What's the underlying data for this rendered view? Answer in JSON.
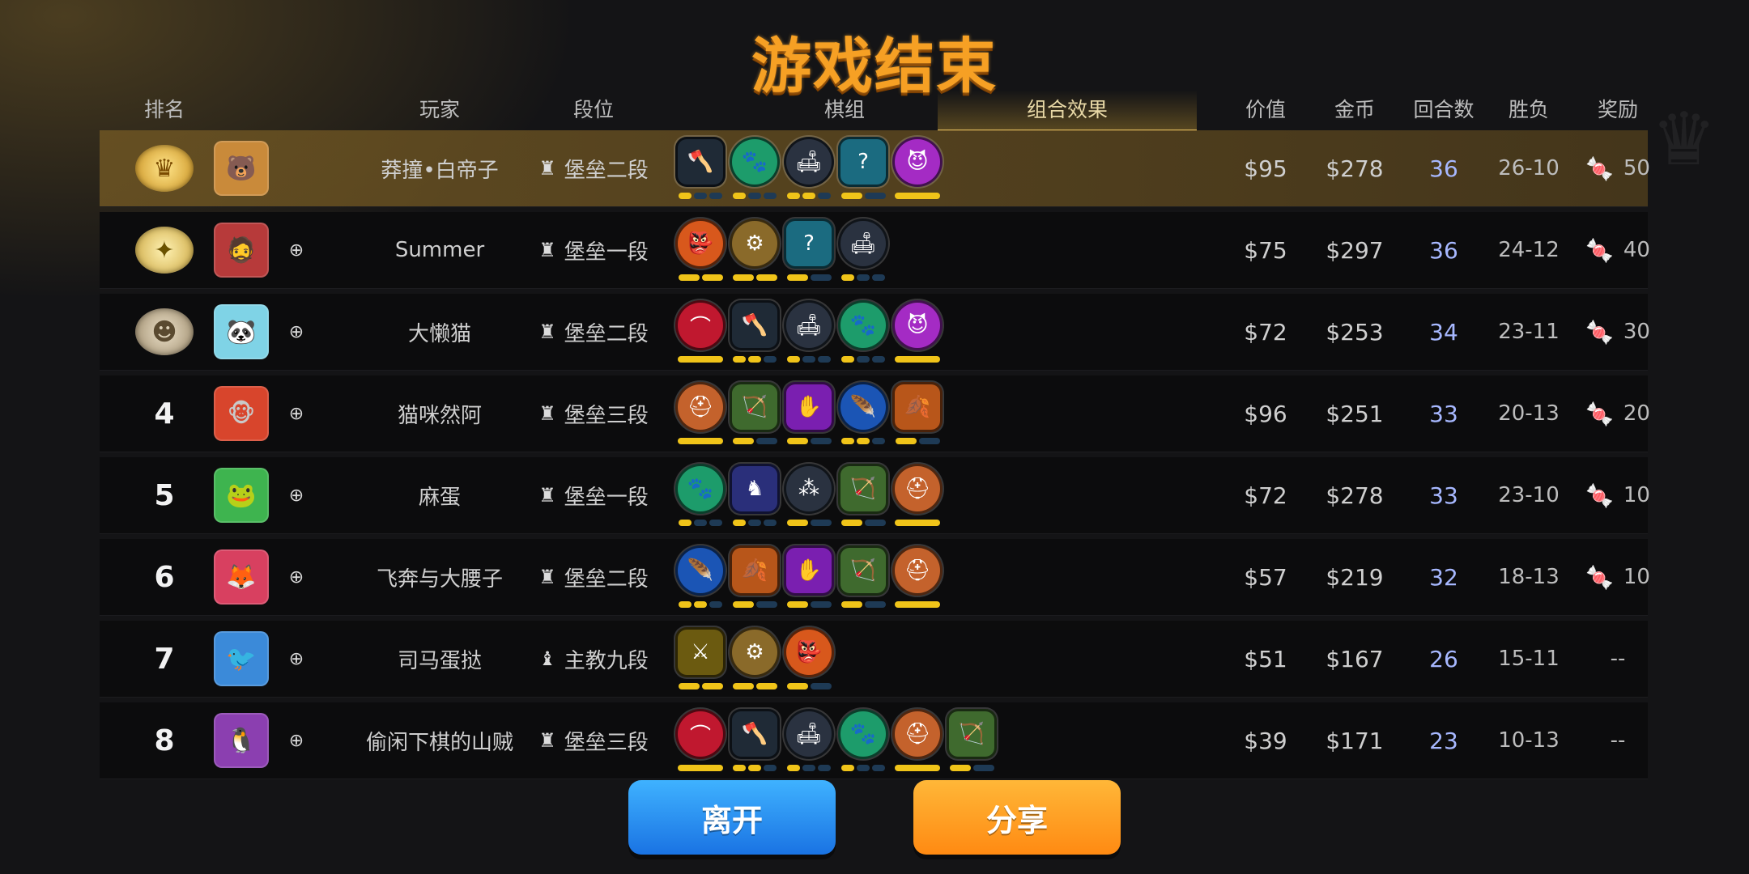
{
  "title": "游戏结束",
  "headers": {
    "rank": "排名",
    "player": "玩家",
    "tier": "段位",
    "pieces": "棋组",
    "synergy_tab": "组合效果",
    "value": "价值",
    "gold": "金币",
    "rounds": "回合数",
    "winloss": "胜负",
    "reward": "奖励"
  },
  "colors": {
    "title": "#f6a024",
    "pip_on": "#f0c419",
    "pip_off": "#1e3a55",
    "rounds": "#a7b8ff",
    "leave": "#1a73e3",
    "share": "#ff8a12"
  },
  "rows": [
    {
      "rank": "1",
      "medal": "gold",
      "avatar": "🐻",
      "avatar_color": "#c98a3a",
      "name": "莽撞•白帝子",
      "tier_icon": "♜",
      "tier": "堡垒二段",
      "value": "$95",
      "gold": "$278",
      "rounds": "36",
      "wl": "26-10",
      "reward_icon": "candy",
      "reward": "50",
      "synergies": [
        {
          "icon": "axe-icon",
          "glyph": "🪓",
          "color": "#1f2a36",
          "shape": "hex",
          "pips": [
            1,
            0,
            0
          ]
        },
        {
          "icon": "paw-icon",
          "glyph": "🐾",
          "color": "#1d9c6b",
          "shape": "circle",
          "pips": [
            1,
            0,
            0
          ]
        },
        {
          "icon": "sofa-icon",
          "glyph": "🛋",
          "color": "#2a3240",
          "shape": "circle",
          "pips": [
            1,
            1,
            0
          ]
        },
        {
          "icon": "mystery-icon",
          "glyph": "?",
          "color": "#1b6b80",
          "shape": "hex",
          "pips": [
            1,
            0
          ]
        },
        {
          "icon": "demon-icon",
          "glyph": "😈",
          "color": "#a42bc4",
          "shape": "circle",
          "pips": [
            1
          ]
        }
      ]
    },
    {
      "rank": "2",
      "medal": "silver-gold",
      "avatar": "🧔",
      "avatar_color": "#b73a3a",
      "name": "Summer",
      "tier_icon": "♜",
      "tier": "堡垒一段",
      "value": "$75",
      "gold": "$297",
      "rounds": "36",
      "wl": "24-12",
      "reward_icon": "candy",
      "reward": "40",
      "synergies": [
        {
          "icon": "goblin-icon",
          "glyph": "👺",
          "color": "#d8581c",
          "shape": "circle",
          "pips": [
            1,
            1
          ]
        },
        {
          "icon": "gear-icon",
          "glyph": "⚙",
          "color": "#8a6a2a",
          "shape": "circle",
          "pips": [
            1,
            1
          ]
        },
        {
          "icon": "mystery-icon",
          "glyph": "?",
          "color": "#1b6b80",
          "shape": "hex",
          "pips": [
            1,
            0
          ]
        },
        {
          "icon": "sofa-icon",
          "glyph": "🛋",
          "color": "#2a3240",
          "shape": "circle",
          "pips": [
            1,
            0,
            0
          ]
        }
      ]
    },
    {
      "rank": "3",
      "medal": "bronze",
      "avatar": "🐼",
      "avatar_color": "#7fd3e6",
      "name": "大懒猫",
      "tier_icon": "♜",
      "tier": "堡垒二段",
      "value": "$72",
      "gold": "$253",
      "rounds": "34",
      "wl": "23-11",
      "reward_icon": "candy",
      "reward": "30",
      "synergies": [
        {
          "icon": "arch-icon",
          "glyph": "⌒",
          "color": "#c0182f",
          "shape": "circle",
          "pips": [
            1
          ]
        },
        {
          "icon": "axe-icon",
          "glyph": "🪓",
          "color": "#1f2a36",
          "shape": "hex",
          "pips": [
            1,
            1,
            0
          ]
        },
        {
          "icon": "sofa-icon",
          "glyph": "🛋",
          "color": "#2a3240",
          "shape": "circle",
          "pips": [
            1,
            0,
            0
          ]
        },
        {
          "icon": "paw-icon",
          "glyph": "🐾",
          "color": "#1d9c6b",
          "shape": "circle",
          "pips": [
            1,
            0,
            0
          ]
        },
        {
          "icon": "demon-icon",
          "glyph": "😈",
          "color": "#a42bc4",
          "shape": "circle",
          "pips": [
            1
          ]
        }
      ]
    },
    {
      "rank": "4",
      "medal": "none",
      "avatar": "🐵",
      "avatar_color": "#d8452c",
      "name": "猫咪然阿",
      "tier_icon": "♜",
      "tier": "堡垒三段",
      "value": "$96",
      "gold": "$251",
      "rounds": "33",
      "wl": "20-13",
      "reward_icon": "candy",
      "reward": "20",
      "synergies": [
        {
          "icon": "viking-icon",
          "glyph": "⛑",
          "color": "#c4622c",
          "shape": "circle",
          "pips": [
            1
          ]
        },
        {
          "icon": "bow-icon",
          "glyph": "🏹",
          "color": "#3f6a2e",
          "shape": "hex",
          "pips": [
            1,
            0
          ]
        },
        {
          "icon": "hand-icon",
          "glyph": "✋",
          "color": "#7a1fb0",
          "shape": "hex",
          "pips": [
            1,
            0
          ]
        },
        {
          "icon": "feather-icon",
          "glyph": "🪶",
          "color": "#1b55b5",
          "shape": "circle",
          "pips": [
            1,
            1,
            0
          ]
        },
        {
          "icon": "leaf-icon",
          "glyph": "🍂",
          "color": "#b8561a",
          "shape": "hex",
          "pips": [
            1,
            0
          ]
        }
      ]
    },
    {
      "rank": "5",
      "medal": "none",
      "avatar": "🐸",
      "avatar_color": "#3eb44f",
      "name": "麻蛋",
      "tier_icon": "♜",
      "tier": "堡垒一段",
      "value": "$72",
      "gold": "$278",
      "rounds": "33",
      "wl": "23-10",
      "reward_icon": "candy",
      "reward": "10",
      "synergies": [
        {
          "icon": "paw-icon",
          "glyph": "🐾",
          "color": "#1d9c6b",
          "shape": "circle",
          "pips": [
            1,
            0,
            0
          ]
        },
        {
          "icon": "kingdom-icon",
          "glyph": "♞",
          "color": "#2a2f7a",
          "shape": "hex",
          "pips": [
            1,
            0,
            0
          ]
        },
        {
          "icon": "dots-icon",
          "glyph": "⁂",
          "color": "#2a3240",
          "shape": "circle",
          "pips": [
            1,
            0
          ]
        },
        {
          "icon": "bow-icon",
          "glyph": "🏹",
          "color": "#3f6a2e",
          "shape": "hex",
          "pips": [
            1,
            0
          ]
        },
        {
          "icon": "viking-icon",
          "glyph": "⛑",
          "color": "#c4622c",
          "shape": "circle",
          "pips": [
            1
          ]
        }
      ]
    },
    {
      "rank": "6",
      "medal": "none",
      "avatar": "🦊",
      "avatar_color": "#d84060",
      "name": "飞奔与大腰子",
      "tier_icon": "♜",
      "tier": "堡垒二段",
      "value": "$57",
      "gold": "$219",
      "rounds": "32",
      "wl": "18-13",
      "reward_icon": "candy",
      "reward": "10",
      "synergies": [
        {
          "icon": "feather-icon",
          "glyph": "🪶",
          "color": "#1b55b5",
          "shape": "circle",
          "pips": [
            1,
            1,
            0
          ]
        },
        {
          "icon": "leaf-icon",
          "glyph": "🍂",
          "color": "#b8561a",
          "shape": "hex",
          "pips": [
            1,
            0
          ]
        },
        {
          "icon": "hand-icon",
          "glyph": "✋",
          "color": "#7a1fb0",
          "shape": "hex",
          "pips": [
            1,
            0
          ]
        },
        {
          "icon": "bow-icon",
          "glyph": "🏹",
          "color": "#3f6a2e",
          "shape": "hex",
          "pips": [
            1,
            0
          ]
        },
        {
          "icon": "viking-icon",
          "glyph": "⛑",
          "color": "#c4622c",
          "shape": "circle",
          "pips": [
            1
          ]
        }
      ]
    },
    {
      "rank": "7",
      "medal": "none",
      "avatar": "🐦",
      "avatar_color": "#3b8ad9",
      "name": "司马蛋挞",
      "tier_icon": "♝",
      "tier": "主教九段",
      "value": "$51",
      "gold": "$167",
      "rounds": "26",
      "wl": "15-11",
      "reward_icon": "",
      "reward": "--",
      "synergies": [
        {
          "icon": "swords-icon",
          "glyph": "⚔",
          "color": "#6b5a10",
          "shape": "hex",
          "pips": [
            1,
            1
          ]
        },
        {
          "icon": "gear-icon",
          "glyph": "⚙",
          "color": "#8a6a2a",
          "shape": "circle",
          "pips": [
            1,
            1
          ]
        },
        {
          "icon": "goblin-icon",
          "glyph": "👺",
          "color": "#d8581c",
          "shape": "circle",
          "pips": [
            1,
            0
          ]
        }
      ]
    },
    {
      "rank": "8",
      "medal": "none",
      "avatar": "🐧",
      "avatar_color": "#8b3fb0",
      "name": "偷闲下棋的山贼",
      "tier_icon": "♜",
      "tier": "堡垒三段",
      "value": "$39",
      "gold": "$171",
      "rounds": "23",
      "wl": "10-13",
      "reward_icon": "",
      "reward": "--",
      "synergies": [
        {
          "icon": "arch-icon",
          "glyph": "⌒",
          "color": "#c0182f",
          "shape": "circle",
          "pips": [
            1
          ]
        },
        {
          "icon": "axe-icon",
          "glyph": "🪓",
          "color": "#1f2a36",
          "shape": "hex",
          "pips": [
            1,
            1,
            0
          ]
        },
        {
          "icon": "sofa-icon",
          "glyph": "🛋",
          "color": "#2a3240",
          "shape": "circle",
          "pips": [
            1,
            0,
            0
          ]
        },
        {
          "icon": "paw-icon",
          "glyph": "🐾",
          "color": "#1d9c6b",
          "shape": "circle",
          "pips": [
            1,
            0,
            0
          ]
        },
        {
          "icon": "viking-icon",
          "glyph": "⛑",
          "color": "#c4622c",
          "shape": "circle",
          "pips": [
            1
          ]
        },
        {
          "icon": "bow-icon",
          "glyph": "🏹",
          "color": "#3f6a2e",
          "shape": "hex",
          "pips": [
            1,
            0
          ]
        }
      ]
    }
  ],
  "buttons": {
    "leave": "离开",
    "share": "分享"
  }
}
